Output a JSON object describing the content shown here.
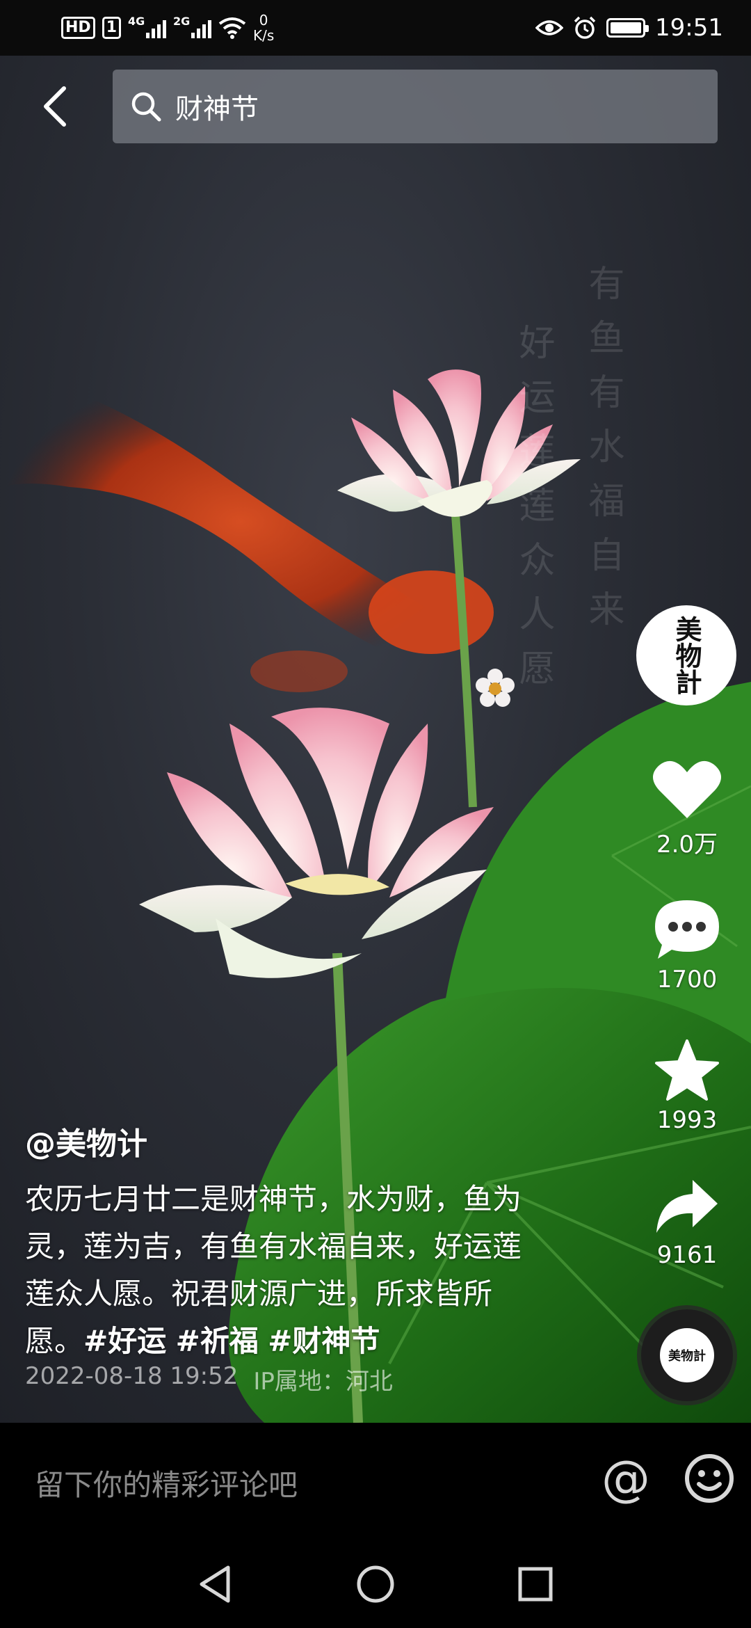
{
  "status_bar": {
    "hd": "HD",
    "sim1": "1",
    "net1": "4G",
    "net2": "2G",
    "speed_value": "0",
    "speed_unit": "K/s",
    "time": "19:51",
    "icons": [
      "eye-icon",
      "alarm-icon",
      "battery-icon"
    ]
  },
  "header": {
    "search_query": "财神节"
  },
  "video": {
    "poem_right": "有鱼有水福自来",
    "poem_left": "好运莲莲众人愿"
  },
  "author_avatar_text": "美物計",
  "actions": {
    "likes": "2.0万",
    "comments": "1700",
    "favorites": "1993",
    "shares": "9161"
  },
  "post": {
    "author": "@美物计",
    "caption": "农历七月廿二是财神节，水为财，鱼为灵，莲为吉，有鱼有水福自来，好运莲莲众人愿。祝君财源广进，所求皆所愿。",
    "tags": [
      "#好运",
      "#祈福",
      "#财神节"
    ],
    "date": "2022-08-18 19:52",
    "ip_location": "IP属地：河北"
  },
  "music_disc_text": "美物計",
  "comment_bar": {
    "placeholder": "留下你的精彩评论吧",
    "at_symbol": "@"
  },
  "colors": {
    "background": "#000000",
    "search_bg": "#787c84",
    "placeholder": "#8a8a8a"
  }
}
